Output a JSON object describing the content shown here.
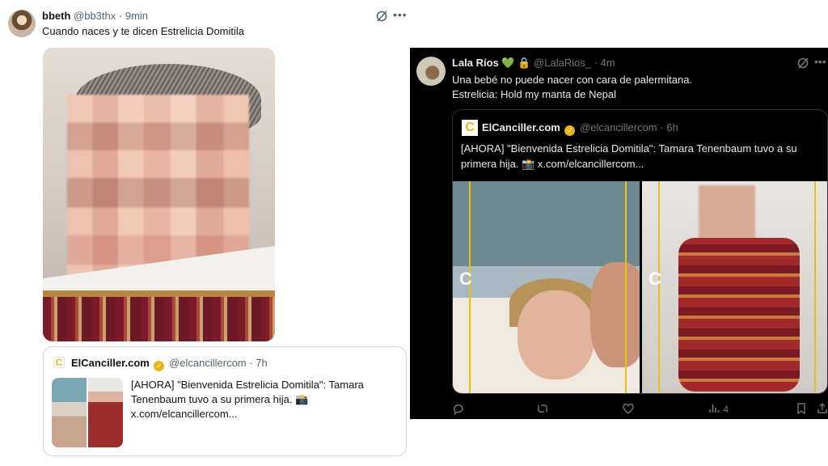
{
  "left_tweet": {
    "user_name": "bbeth",
    "handle": "@bb3thx",
    "time": "9min",
    "text": "Cuando naces y te dicen Estrelicia Domitila",
    "quote": {
      "account_name": "ElCanciller.com",
      "handle": "@elcancillercom",
      "time": "7h",
      "text": "[AHORA] \"Bienvenida Estrelicia Domitila\": Tamara Tenenbaum tuvo a su primera hija. 📸 x.com/elcancillercom..."
    }
  },
  "right_tweet": {
    "user_name": "Lala Ríos",
    "handle": "@LalaRios_",
    "time": "4m",
    "text_line1": "Una bebé no puede nacer con cara de palermitana.",
    "text_line2": "Estrelicia: Hold my manta de Nepal",
    "quote": {
      "account_name": "ElCanciller.com",
      "handle": "@elcancillercom",
      "time": "6h",
      "text": "[AHORA] \"Bienvenida Estrelicia Domitila\": Tamara Tenenbaum tuvo a su primera hija. 📸 x.com/elcancillercom..."
    },
    "views_count": "4"
  },
  "icons": {
    "more": "more-horizontal-icon",
    "grok": "grok-icon",
    "reply": "reply-icon",
    "retweet": "retweet-icon",
    "like": "like-icon",
    "views": "views-icon",
    "bookmark": "bookmark-icon",
    "share": "share-icon"
  },
  "colors": {
    "verified_gold": "#e8b516",
    "brand_yellow": "#e3bb1c",
    "dark_bg": "#000000",
    "light_bg": "#ffffff"
  }
}
